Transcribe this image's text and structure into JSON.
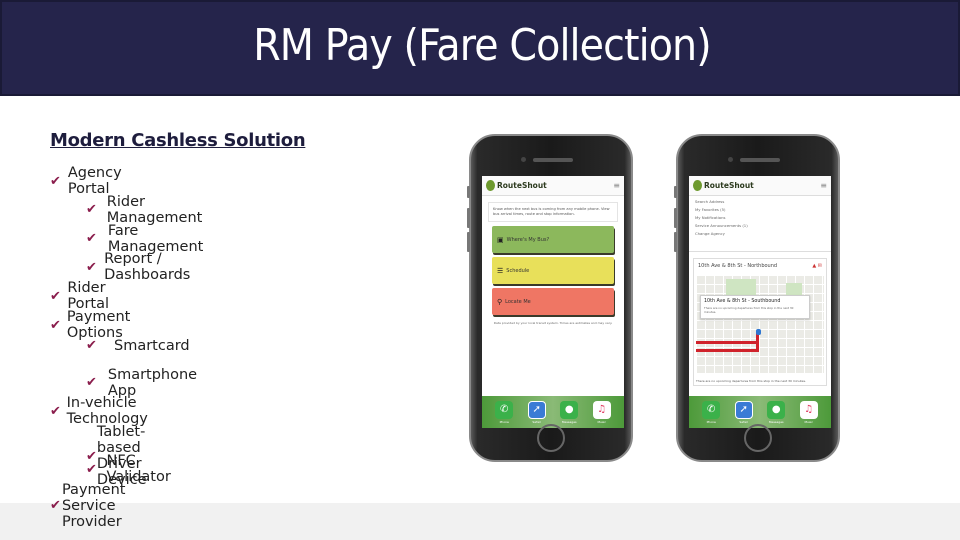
{
  "slide": {
    "title": "RM Pay (Fare Collection)",
    "subtitle": "Modern Cashless Solution",
    "check_glyph": "✔",
    "accent_color": "#8a1d4c",
    "header_color": "#25244b",
    "bullets": [
      {
        "level": 1,
        "text": "Agency Portal"
      },
      {
        "level": 2,
        "text": "Rider Management"
      },
      {
        "level": 2,
        "text": "Fare Management"
      },
      {
        "level": 2,
        "text": "Report / Dashboards"
      },
      {
        "level": 1,
        "text": "Rider Portal"
      },
      {
        "level": 1,
        "text": "Payment Options"
      },
      {
        "level": 2,
        "text": "Smartcard"
      },
      {
        "level": 2,
        "text": "Smartphone App"
      },
      {
        "level": 1,
        "text": "In-vehicle Technology"
      },
      {
        "level": 2,
        "text": "Tablet-based Driver Device"
      },
      {
        "level": 2,
        "text": "NFC Validator"
      },
      {
        "level": 1,
        "text": "Payment Service Provider"
      }
    ]
  },
  "phone_left": {
    "app_name": "RouteShout",
    "menu_icon": "≡",
    "intro_text": "Know when the next bus is coming from any mobile phone. View bus arrival times, route and stop information.",
    "tiles": [
      {
        "label": "Where's My Bus?",
        "icon": "bus-icon",
        "glyph": "▣",
        "color": "#8cb85c"
      },
      {
        "label": "Schedule",
        "icon": "list-icon",
        "glyph": "☰",
        "color": "#e8e05a"
      },
      {
        "label": "Locate Me",
        "icon": "location-pin-icon",
        "glyph": "⚲",
        "color": "#ef7664"
      }
    ],
    "footnote": "Data provided by your local transit system. Times are estimates and may vary."
  },
  "phone_right": {
    "app_name": "RouteShout",
    "menu_icon": "≡",
    "menu_items": [
      "Search Address",
      "My Favorites (5)",
      "My Notifications",
      "Service Announcements (1)",
      "Change Agency"
    ],
    "map_title": "10th Ave & 8th St - Northbound",
    "popup_title": "10th Ave & 8th St - Southbound",
    "popup_sub": "There are no upcoming departures from this stop in the next 30 minutes.",
    "map_note": "There are no upcoming departures from this stop in the next 30 minutes."
  },
  "dock": [
    {
      "label": "Phone",
      "glyph": "✆"
    },
    {
      "label": "Safari",
      "glyph": "➚"
    },
    {
      "label": "Messages",
      "glyph": "●"
    },
    {
      "label": "Music",
      "glyph": "♫"
    }
  ]
}
